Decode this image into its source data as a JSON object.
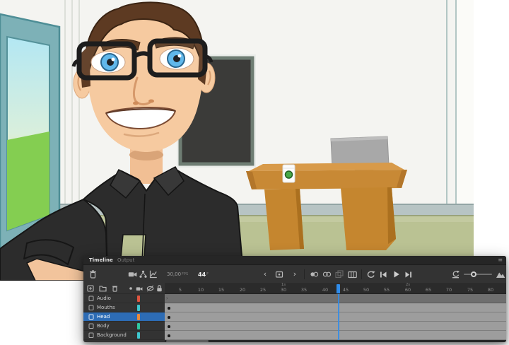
{
  "page": {
    "background": "#ffffff"
  },
  "stage": {
    "elements": [
      "cartoon-man-with-glasses",
      "window-with-grass-view",
      "blackboard",
      "wooden-desk",
      "computer-monitor",
      "coffee-cup",
      "office-wall",
      "floor"
    ],
    "colors": {
      "wall": "#f4f4f1",
      "baseboard": "#b7c4c4",
      "floor": "#bac293",
      "window_frame": "#7db1b7",
      "sky": "#b3e7f3",
      "grass": "#84ce51",
      "board": "#3b3b39",
      "board_frame": "#6e7d73",
      "desk": "#c88935",
      "monitor": "#a8a8a8",
      "shirt": "#2c2c2c",
      "skin": "#f6caa0",
      "hair": "#5d3a22",
      "iris": "#59b5ea"
    }
  },
  "timeline": {
    "tabs": [
      {
        "label": "Timeline",
        "active": true
      },
      {
        "label": "Output",
        "active": false
      }
    ],
    "panel_menu_glyph": "≡",
    "toolbar": {
      "fps": {
        "value": "30,00",
        "unit": "FPS"
      },
      "current_frame": {
        "value": "44",
        "unit": "F"
      },
      "prev_glyph": "‹",
      "next_glyph": "›",
      "icons": [
        "delete",
        "camera",
        "parenting-view",
        "graph-editor",
        "previous-frame",
        "loop-frame-range",
        "next-frame",
        "onion-skin",
        "onion-skin-outlines",
        "edit-multiple-frames",
        "camera-frame",
        "loop-playback",
        "step-back",
        "play",
        "step-forward",
        "reset-timeline-zoom",
        "zoom-slider",
        "resize-timeline-view"
      ]
    },
    "layers_header_icons": [
      "new-layer",
      "new-folder",
      "delete-layer",
      "outline-color",
      "camera",
      "hide-all-layers",
      "lock-all-layers"
    ],
    "ruler": {
      "ticks": [
        "5",
        "10",
        "15",
        "20",
        "25",
        "30",
        "35",
        "40",
        "45",
        "50",
        "55",
        "60",
        "65",
        "70",
        "75",
        "80"
      ],
      "seconds": [
        "1s",
        "2s"
      ],
      "playhead_frame": 44
    },
    "layers": [
      {
        "name": "Audio",
        "color": "#e0543f",
        "selected": false
      },
      {
        "name": "Mouths",
        "color": "#3ec6ce",
        "selected": false
      },
      {
        "name": "Head",
        "color": "#e98a3c",
        "selected": true
      },
      {
        "name": "Body",
        "color": "#2fc89f",
        "selected": false
      },
      {
        "name": "Background",
        "color": "#3ec6ce",
        "selected": false
      }
    ],
    "selection_color": "#2d6cb5",
    "playhead_color": "#2f8ceb"
  }
}
